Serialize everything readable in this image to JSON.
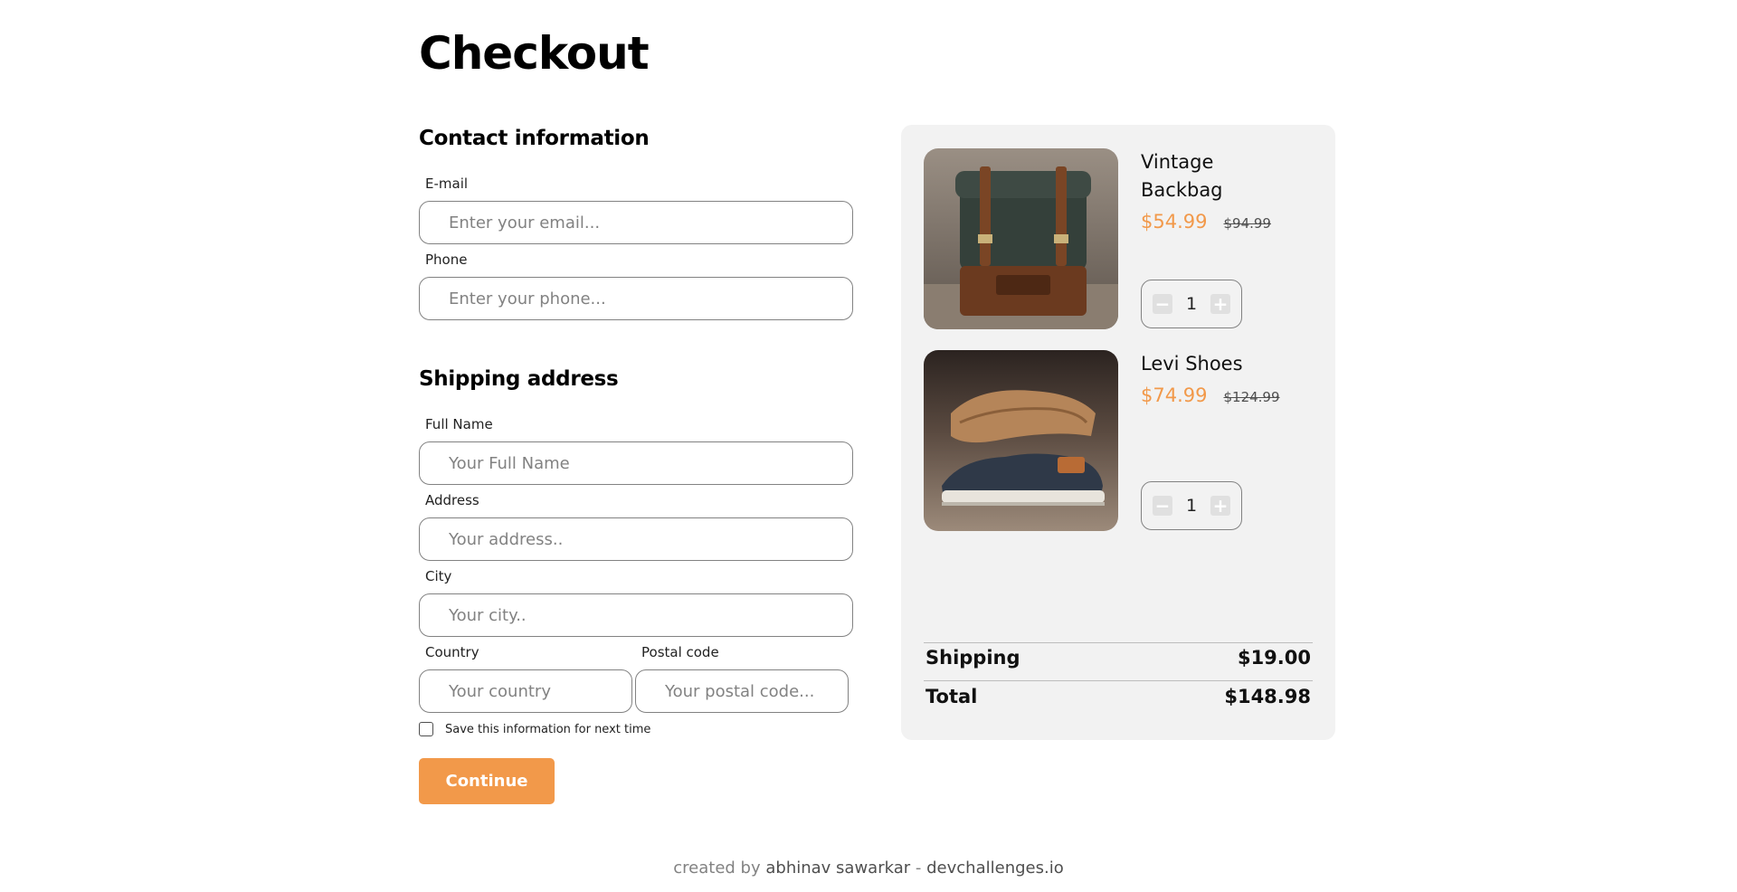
{
  "page": {
    "title": "Checkout"
  },
  "contact": {
    "heading": "Contact information",
    "email_label": "E-mail",
    "email_placeholder": "Enter your email...",
    "phone_label": "Phone",
    "phone_placeholder": "Enter your phone..."
  },
  "shipping_address": {
    "heading": "Shipping address",
    "full_name_label": "Full Name",
    "full_name_placeholder": "Your Full Name",
    "address_label": "Address",
    "address_placeholder": "Your address..",
    "city_label": "City",
    "city_placeholder": "Your city..",
    "country_label": "Country",
    "country_placeholder": "Your country",
    "postal_label": "Postal code",
    "postal_placeholder": "Your postal code...",
    "save_label": "Save this information for next time",
    "save_checked": false
  },
  "actions": {
    "continue_label": "Continue"
  },
  "cart": {
    "items": [
      {
        "name": "Vintage Backbag",
        "price": "$54.99",
        "old_price": "$94.99",
        "quantity": "1",
        "minus": "−",
        "plus": "+"
      },
      {
        "name": "Levi Shoes",
        "price": "$74.99",
        "old_price": "$124.99",
        "quantity": "1",
        "minus": "−",
        "plus": "+"
      }
    ],
    "shipping_label": "Shipping",
    "shipping_value": "$19.00",
    "total_label": "Total",
    "total_value": "$148.98"
  },
  "footer": {
    "prefix": "created by",
    "author": "abhinav sawarkar",
    "separator": "-",
    "site": "devchallenges.io"
  },
  "colors": {
    "accent": "#F2994A",
    "panel": "#F2F2F2",
    "border": "#828282"
  }
}
